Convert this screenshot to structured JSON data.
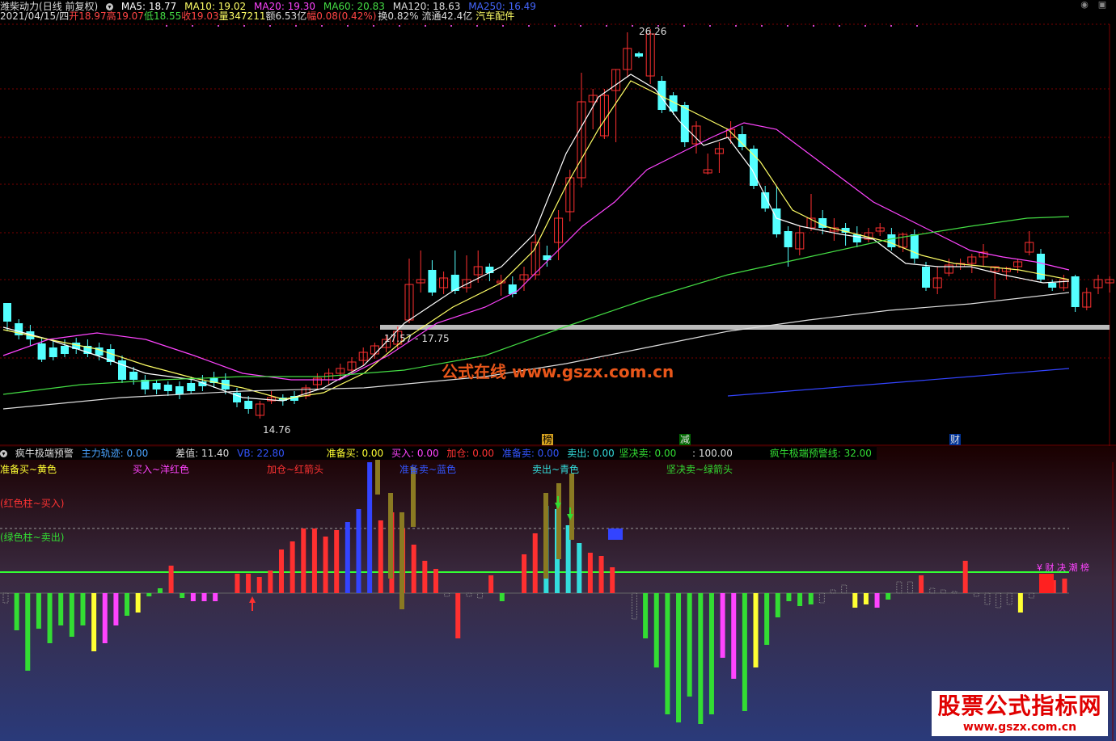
{
  "header": {
    "stock_name": "潍柴动力",
    "period": "(日线 前复权)",
    "ma": [
      {
        "label": "MA5: 18.77",
        "color": "#ffffff"
      },
      {
        "label": "MA10: 19.02",
        "color": "#ffff66"
      },
      {
        "label": "MA20: 19.30",
        "color": "#ff44ff"
      },
      {
        "label": "MA60: 20.83",
        "color": "#44dd44"
      },
      {
        "label": "MA120: 18.63",
        "color": "#dddddd"
      },
      {
        "label": "MA250: 16.49",
        "color": "#4466ff"
      }
    ]
  },
  "quote": {
    "date": "2021/04/15/四",
    "open": "开18.97",
    "high": "高19.07",
    "low": "低18.55",
    "close": "收19.03",
    "volume": "量347211",
    "amount": "额6.53亿",
    "change": "幅0.08(0.42%)",
    "turnover": "换0.82%",
    "float": "流通42.4亿",
    "sector": "汽车配件"
  },
  "price_chart": {
    "max_label": "26.26",
    "min_label": "14.76",
    "support_label": "17.57 - 17.75",
    "markers": [
      "榜",
      "减",
      "财"
    ],
    "watermark": "公式在线  www.gszx.com.cn"
  },
  "indicator": {
    "name": "疯牛极端预警",
    "values": [
      {
        "label": "主力轨迹: 0.00",
        "color": "#4aa3ff"
      },
      {
        "label": "差值: 11.40",
        "color": "#dddddd"
      },
      {
        "label": "VB: 22.80",
        "color": "#3355ff"
      },
      {
        "label": "准备买: 0.00",
        "color": "#ffff33"
      },
      {
        "label": "买入: 0.00",
        "color": "#ff44ff"
      },
      {
        "label": "加仓: 0.00",
        "color": "#ff3333"
      },
      {
        "label": "准备卖: 0.00",
        "color": "#3355ff"
      },
      {
        "label": "卖出: 0.00",
        "color": "#33dddd"
      },
      {
        "label": "坚决卖: 0.00",
        "color": "#33dd33"
      },
      {
        "label": ": 100.00",
        "color": "#dddddd"
      },
      {
        "label": "疯牛极端预警线: 32.00",
        "color": "#33dd33"
      }
    ],
    "legends": [
      {
        "text": "准备买~黄色",
        "color": "#ffff33"
      },
      {
        "text": "买入~洋红色",
        "color": "#ff44ff"
      },
      {
        "text": "加仓~红箭头",
        "color": "#ff3333"
      },
      {
        "text": "准备卖~蓝色",
        "color": "#3355ff"
      },
      {
        "text": "卖出~青色",
        "color": "#33dddd"
      },
      {
        "text": "坚决卖~绿箭头",
        "color": "#33dd33"
      },
      {
        "text": "(红色柱~买入)",
        "color": "#ff3333"
      },
      {
        "text": "(绿色柱~卖出)",
        "color": "#33dd33"
      }
    ],
    "right_note": "¥ 财 决 潮 榜"
  },
  "watermark": {
    "main": "股票公式指标网",
    "sub": "www.gszx.com.cn"
  }
}
